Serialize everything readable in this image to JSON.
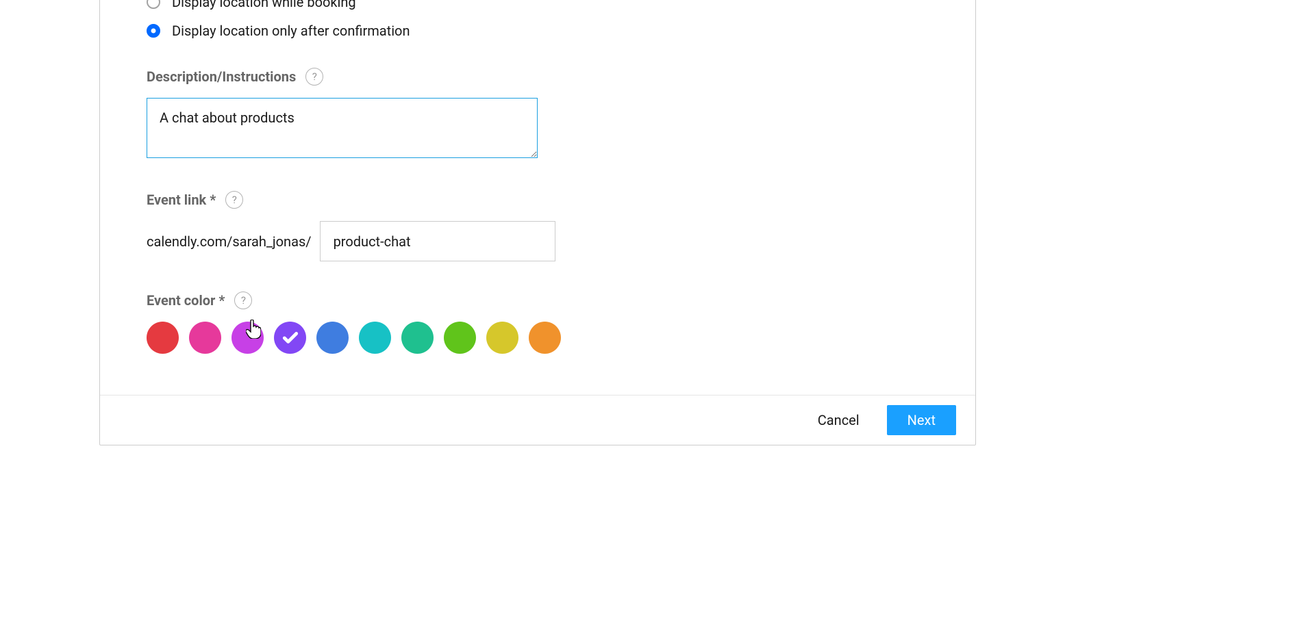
{
  "radios": {
    "option1": {
      "label": "Display location while booking",
      "selected": false
    },
    "option2": {
      "label": "Display location only after confirmation",
      "selected": true
    }
  },
  "description": {
    "label": "Description/Instructions",
    "value": "A chat about products"
  },
  "event_link": {
    "label": "Event link *",
    "prefix": "calendly.com/sarah_jonas/",
    "value": "product-chat"
  },
  "event_color": {
    "label": "Event color *",
    "selected_index": 3,
    "options": [
      {
        "name": "red",
        "hex": "#e53a40"
      },
      {
        "name": "pink",
        "hex": "#e6399b"
      },
      {
        "name": "magenta",
        "hex": "#c740e6"
      },
      {
        "name": "purple",
        "hex": "#8247f5"
      },
      {
        "name": "blue",
        "hex": "#3f7de0"
      },
      {
        "name": "teal",
        "hex": "#17c1c5"
      },
      {
        "name": "green",
        "hex": "#1fc08f"
      },
      {
        "name": "lime",
        "hex": "#60c41b"
      },
      {
        "name": "yellow",
        "hex": "#d6c72b"
      },
      {
        "name": "orange",
        "hex": "#f0922c"
      }
    ]
  },
  "footer": {
    "cancel": "Cancel",
    "next": "Next"
  },
  "help_glyph": "?"
}
